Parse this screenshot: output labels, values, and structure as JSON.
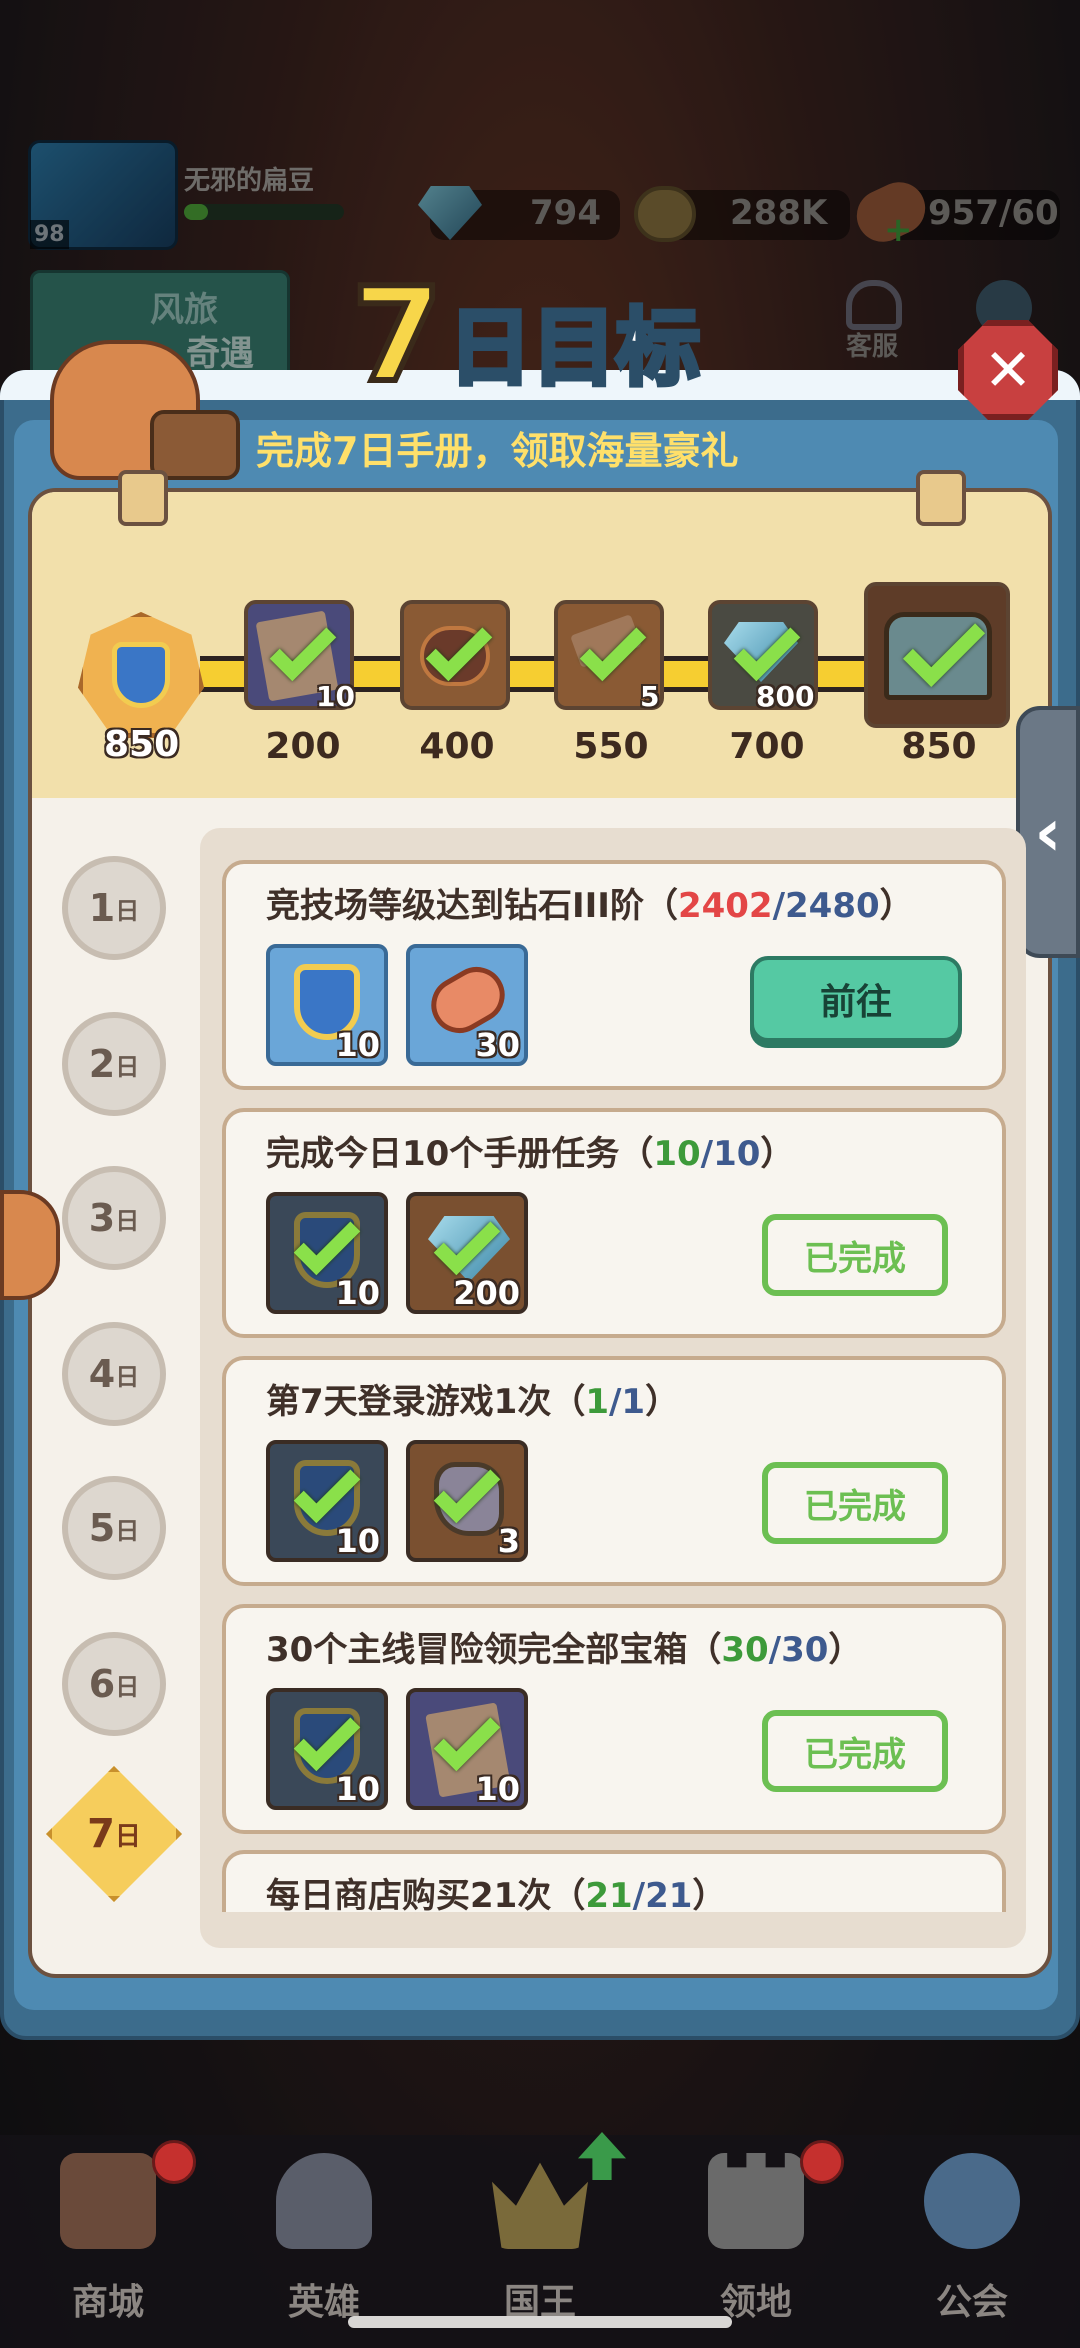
{
  "player": {
    "name": "无邪的扁豆",
    "level": "98"
  },
  "resources": {
    "gems": "794",
    "coins": "288K",
    "stamina": "957/60"
  },
  "event_banner": {
    "line1": "风旅",
    "line2": "奇遇"
  },
  "customer_service": "客服",
  "modal": {
    "title_number": "7",
    "title_text": "日目标",
    "subtitle": "完成7日手册，领取海量豪礼"
  },
  "progress": {
    "current": "850",
    "milestones": [
      {
        "label": "200",
        "count": "10",
        "icon": "manual-icon",
        "done": true
      },
      {
        "label": "400",
        "count": "",
        "icon": "meat-pie-icon",
        "done": true
      },
      {
        "label": "550",
        "count": "5",
        "icon": "hammer-icon",
        "done": true
      },
      {
        "label": "700",
        "count": "800",
        "icon": "diamond-icon",
        "done": true
      },
      {
        "label": "850",
        "count": "",
        "icon": "treasure-chest-icon",
        "done": true
      }
    ]
  },
  "days": [
    {
      "num": "1",
      "suffix": "日"
    },
    {
      "num": "2",
      "suffix": "日"
    },
    {
      "num": "3",
      "suffix": "日"
    },
    {
      "num": "4",
      "suffix": "日"
    },
    {
      "num": "5",
      "suffix": "日"
    },
    {
      "num": "6",
      "suffix": "日"
    },
    {
      "num": "7",
      "suffix": "日"
    }
  ],
  "tasks": [
    {
      "title": "竞技场等级达到钻石III阶（",
      "cur": "2402",
      "slash": "/",
      "tot": "2480",
      "close": "）",
      "rewards": [
        {
          "icon": "shield-badge-icon",
          "count": "10"
        },
        {
          "icon": "meat-icon",
          "count": "30"
        }
      ],
      "button": "前往"
    },
    {
      "title": "完成今日10个手册任务（",
      "cur": "10",
      "slash": "/",
      "tot": "10",
      "close": "）",
      "rewards": [
        {
          "icon": "shield-badge-icon",
          "count": "10"
        },
        {
          "icon": "diamond-icon",
          "count": "200"
        }
      ],
      "button": "已完成"
    },
    {
      "title": "第7天登录游戏1次（",
      "cur": "1",
      "slash": "/",
      "tot": "1",
      "close": "）",
      "rewards": [
        {
          "icon": "shield-badge-icon",
          "count": "10"
        },
        {
          "icon": "ore-icon",
          "count": "3"
        }
      ],
      "button": "已完成"
    },
    {
      "title": "30个主线冒险领完全部宝箱（",
      "cur": "30",
      "slash": "/",
      "tot": "30",
      "close": "）",
      "rewards": [
        {
          "icon": "shield-badge-icon",
          "count": "10"
        },
        {
          "icon": "manual-icon",
          "count": "10"
        }
      ],
      "button": "已完成"
    },
    {
      "title": "每日商店购买21次（",
      "cur": "21",
      "slash": "/",
      "tot": "21",
      "close": "）"
    }
  ],
  "nav": [
    "商城",
    "英雄",
    "国王",
    "领地",
    "公会"
  ]
}
